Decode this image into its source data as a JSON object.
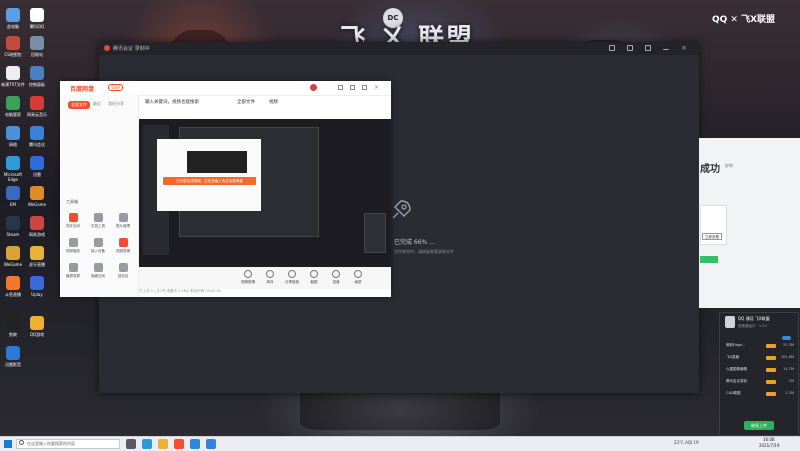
{
  "desktop": {
    "brand_title": "飞 ㄨ 联盟",
    "brand_badge": "DC",
    "brand_corner": "QQ ✕ 飞X联盟",
    "icons": [
      {
        "label": "此电脑",
        "color": "#5aa0e6"
      },
      {
        "label": "腾讯QQ",
        "color": "#ffffff"
      },
      {
        "label": "CS地图包",
        "color": "#c24b3b"
      },
      {
        "label": "回收站",
        "color": "#7a8da6"
      },
      {
        "label": "新建TXT文件",
        "color": "#eeeeee"
      },
      {
        "label": "控制面板",
        "color": "#4a7fc4"
      },
      {
        "label": "电脑管家",
        "color": "#3aa05a"
      },
      {
        "label": "网易云音乐",
        "color": "#d83a3a"
      },
      {
        "label": "网络",
        "color": "#4a90d9"
      },
      {
        "label": "腾讯会议",
        "color": "#3a7fd9"
      },
      {
        "label": "Microsoft Edge",
        "color": "#2e9bd8"
      },
      {
        "label": "迅雷",
        "color": "#2e6bd8"
      },
      {
        "label": "EM",
        "color": "#3a6ac0"
      },
      {
        "label": "WeGame",
        "color": "#e08a2a"
      },
      {
        "label": "Steam",
        "color": "#27364a"
      },
      {
        "label": "网易游戏",
        "color": "#cc4444"
      },
      {
        "label": "WeGame",
        "color": "#d9a23a"
      },
      {
        "label": "虎牙直播",
        "color": "#e9b23a"
      },
      {
        "label": "斗鱼直播",
        "color": "#f07a2a"
      },
      {
        "label": "Uplay",
        "color": "#3a6ad9"
      },
      {
        "label": "剪映",
        "color": "#222222"
      },
      {
        "label": "QQ游戏",
        "color": "#f0b030"
      },
      {
        "label": "迅雷影音",
        "color": "#2a7ad9"
      }
    ]
  },
  "dark_window": {
    "title": "腾讯会议 录制中",
    "progress_text": "已完成 66% ...",
    "progress_sub": "文件转码中，请稍候查看录制文件"
  },
  "light_window": {
    "logo": "百度网盘",
    "tag": "SVIP",
    "side_tabs": [
      "全部文件",
      "最近",
      "我的分享"
    ],
    "side_label": "工具箱",
    "tools": [
      {
        "label": "同步空间",
        "color": "#f24d2f"
      },
      {
        "label": "文档工具",
        "color": "#9a9aa3"
      },
      {
        "label": "照片管理",
        "color": "#9a9aa3"
      },
      {
        "label": "视频播放",
        "color": "#9a9aa3"
      },
      {
        "label": "接入设备",
        "color": "#9a9aa3"
      },
      {
        "label": "视频剪辑",
        "color": "#f24d2f"
      },
      {
        "label": "截屏录屏",
        "color": "#9a9aa3"
      },
      {
        "label": "隐藏空间",
        "color": "#9a9aa3"
      },
      {
        "label": "回收站",
        "color": "#9a9aa3"
      }
    ],
    "main_tabs": [
      "输入关键词，视频也能搜索",
      "全部文件",
      "视频"
    ],
    "toast": "已为您生成视频，正在准备上传至百度网盘",
    "bottom_tools": [
      "视频剪辑",
      "转存",
      "分享链接",
      "截图",
      "倍速",
      "画质"
    ],
    "status": "已上传 0 / 共1项    准备中    0.0B/s    剩余时间 00:00:00"
  },
  "right_panel": {
    "title": "成功",
    "sub": "好的",
    "box_button": "立即查看"
  },
  "popup": {
    "title": "QQ 通话 飞X联盟",
    "sub": "语音通话中 · 1:53",
    "rows": [
      {
        "label": "微软Edge...",
        "value": "52.3M"
      },
      {
        "label": "飞X直播",
        "value": "102.6M"
      },
      {
        "label": "六翼图像编辑",
        "value": "14.7M"
      },
      {
        "label": "腾讯会议录制",
        "value": "1M"
      },
      {
        "label": "CAD看图",
        "value": "1.2M"
      }
    ],
    "button": "继续上传"
  },
  "taskbar": {
    "search_placeholder": "在这里输入你要搜索的内容",
    "apps": [
      {
        "name": "task-view",
        "color": "#5a5a66"
      },
      {
        "name": "edge",
        "color": "#2e9bd8"
      },
      {
        "name": "explorer",
        "color": "#e8b23a"
      },
      {
        "name": "baidu-netdisk",
        "color": "#f24d2f"
      },
      {
        "name": "qq",
        "color": "#2a8ad9"
      },
      {
        "name": "meeting",
        "color": "#3a7fd9"
      }
    ],
    "weather": "23°C  AQI 19",
    "time": "16:08",
    "date": "2021/7/19"
  }
}
